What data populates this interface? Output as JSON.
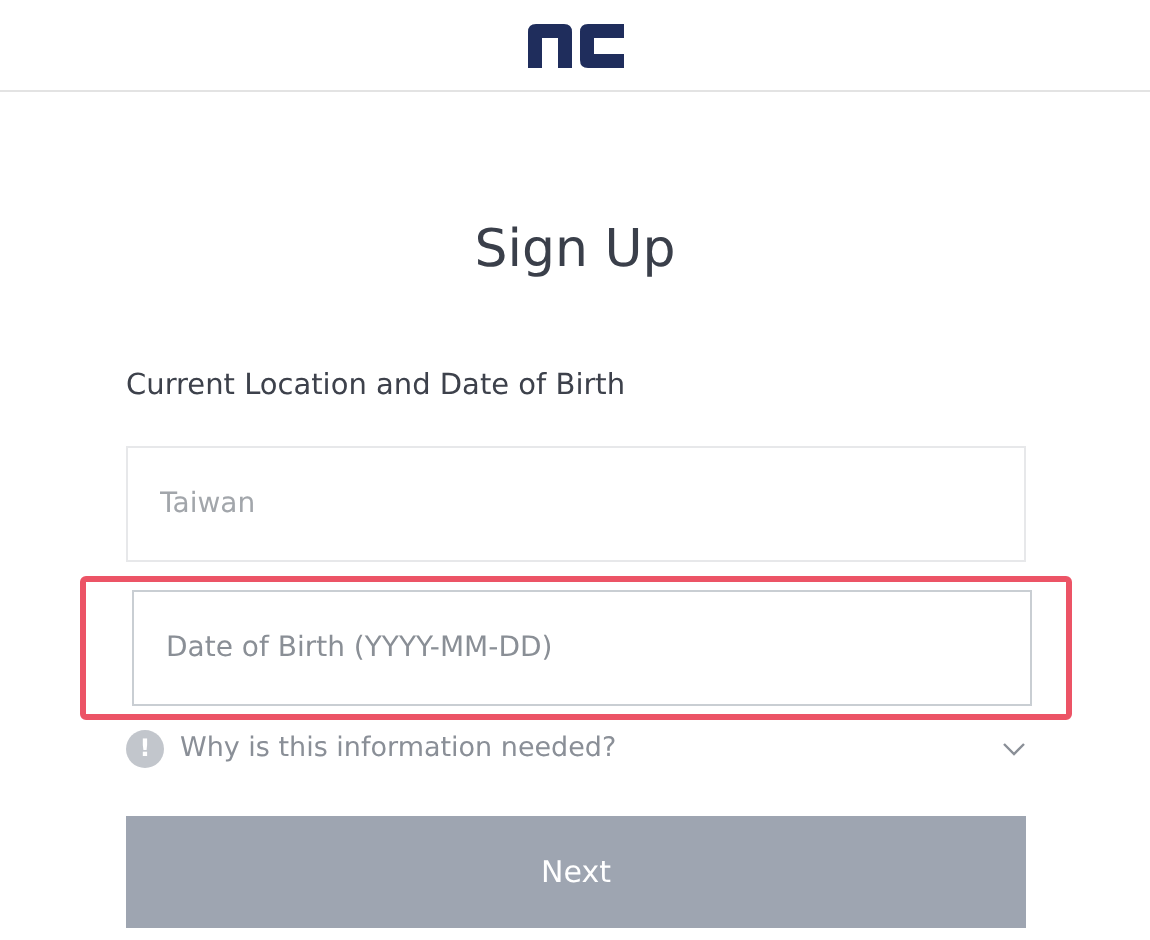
{
  "title": "Sign Up",
  "section_label": "Current Location and Date of Birth",
  "fields": [
    {
      "value": "Taiwan",
      "disabled": true,
      "highlighted": false
    },
    {
      "placeholder": "Date of Birth (YYYY-MM-DD)",
      "disabled": false,
      "highlighted": true
    }
  ],
  "help": {
    "text": "Why is this information needed?",
    "icon": "!",
    "expanded": false
  },
  "button": {
    "label": "Next",
    "disabled": true
  }
}
